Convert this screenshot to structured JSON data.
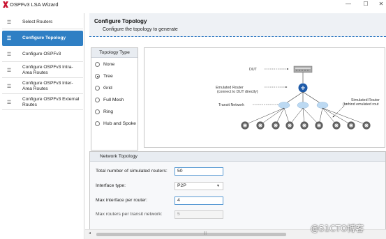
{
  "window": {
    "title": "OSPFv3 LSA Wizard",
    "minimize_glyph": "—",
    "maximize_glyph": "☐",
    "close_glyph": "✕",
    "logo_icon": "x-logo-icon",
    "logo_color": "#c8102e"
  },
  "sidebar": {
    "items": [
      {
        "label": "Select Routers",
        "active": false
      },
      {
        "label": "Configure Topology",
        "active": true
      },
      {
        "label": "Configure OSPFv3",
        "active": false
      },
      {
        "label": "Configure OSPFv3 Intra-\nArea Routes",
        "active": false
      },
      {
        "label": "Configure OSPFv3 Inter-\nArea Routes",
        "active": false
      },
      {
        "label": "Configure OSPFv3 External\nRoutes",
        "active": false
      }
    ],
    "item_icon": "menu-lines-icon",
    "item_glyph": "☰",
    "accent": "#2f7fc4"
  },
  "header": {
    "title": "Configure Topology",
    "subtitle": "Configure the topology to generate"
  },
  "topology_type": {
    "title": "Topology Type",
    "options": [
      "None",
      "Tree",
      "Grid",
      "Full Mesh",
      "Ring",
      "Hub and Spoke"
    ],
    "selected": "Tree"
  },
  "diagram": {
    "labels": {
      "dut": "DUT",
      "emulated_router_1": "Emulated Router",
      "emulated_router_2": "(connect to DUT directly)",
      "transit_network": "Transit Network",
      "simulated_router_1": "Simulated Router",
      "simulated_router_2": "(behind emulated rout"
    },
    "router_color": "#1e5aa8",
    "cloud_color": "#bcd9f2",
    "leaf_color": "#5f5f5f"
  },
  "network_topology": {
    "title": "Network Topology",
    "fields": {
      "total_routers_label": "Total number of simulated routers:",
      "total_routers_value": "50",
      "interface_type_label": "Interface type:",
      "interface_type_value": "P2P",
      "max_interface_label": "Max interface per router:",
      "max_interface_value": "4",
      "max_routers_transit_label": "Max routers per transit network:",
      "max_routers_transit_value": "5"
    }
  },
  "scrollbar": {
    "left_arrow": "◂",
    "grip": "|||"
  },
  "watermark": "@51CTO博客"
}
